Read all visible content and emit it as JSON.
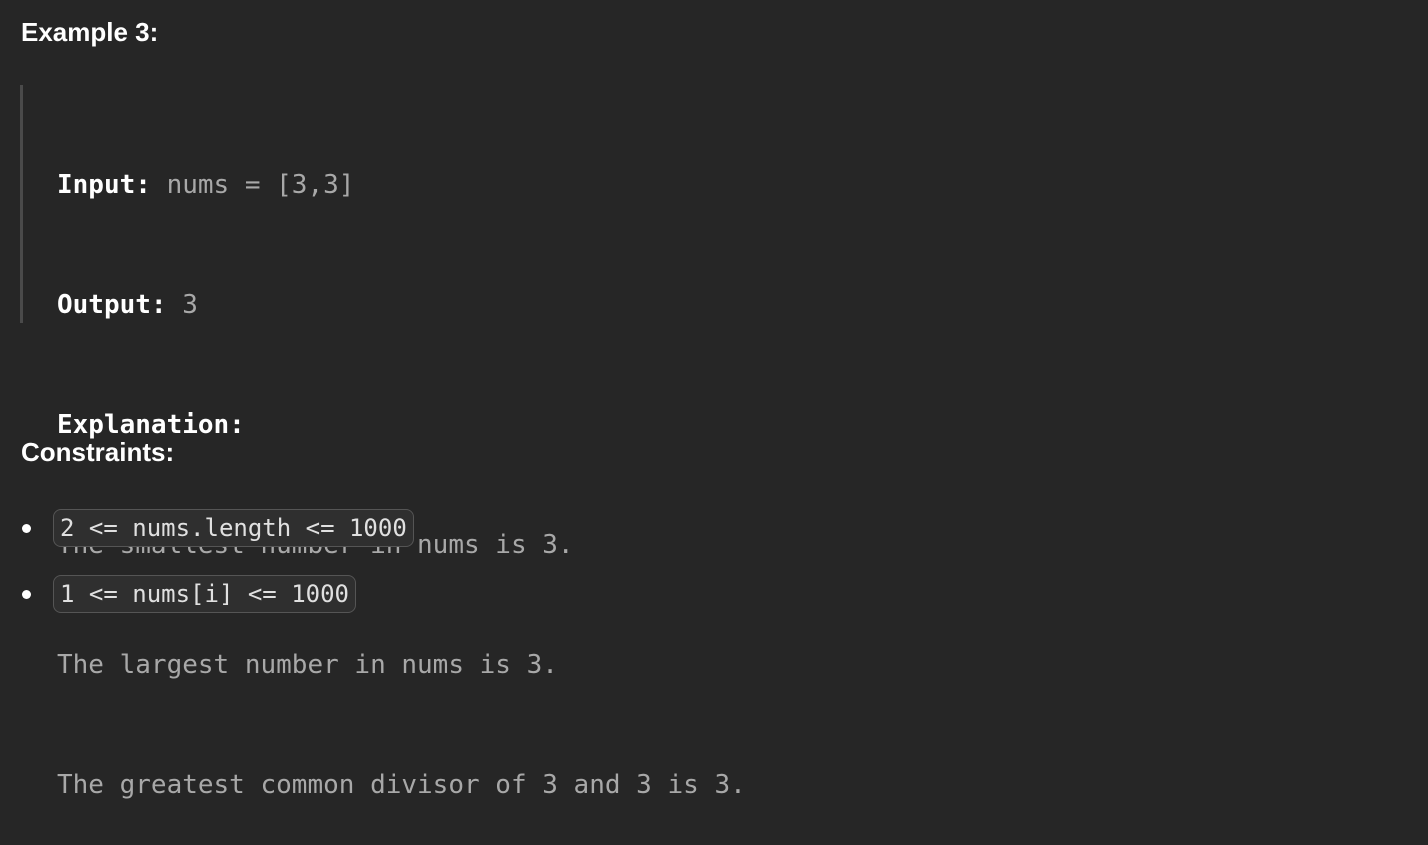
{
  "example": {
    "heading": "Example 3:",
    "input_label": "Input:",
    "input_value": " nums = [3,3]",
    "output_label": "Output:",
    "output_value": " 3",
    "explanation_label": "Explanation:",
    "explanation_lines": [
      "The smallest number in nums is 3.",
      "The largest number in nums is 3.",
      "The greatest common divisor of 3 and 3 is 3."
    ]
  },
  "constraints": {
    "heading": "Constraints:",
    "items": [
      "2 <= nums.length <= 1000",
      "1 <= nums[i] <= 1000"
    ]
  }
}
